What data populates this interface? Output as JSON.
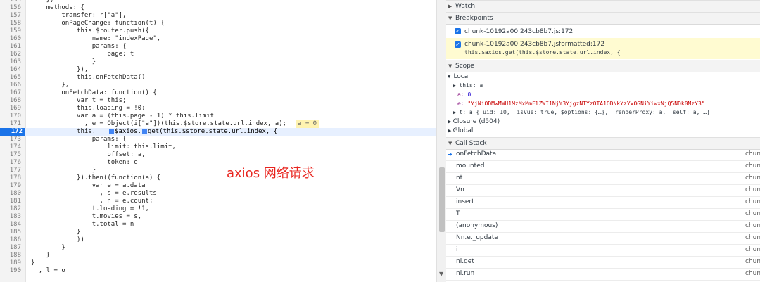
{
  "editor": {
    "lines": [
      {
        "n": "155",
        "code": "    },"
      },
      {
        "n": "156",
        "code": "    methods: {"
      },
      {
        "n": "157",
        "code": "        transfer: r[\"a\"],"
      },
      {
        "n": "158",
        "code": "        onPageChange: function(t) {"
      },
      {
        "n": "159",
        "code": "            this.$router.push({"
      },
      {
        "n": "160",
        "code": "                name: \"indexPage\","
      },
      {
        "n": "161",
        "code": "                params: {"
      },
      {
        "n": "162",
        "code": "                    page: t"
      },
      {
        "n": "163",
        "code": "                }"
      },
      {
        "n": "164",
        "code": "            }),"
      },
      {
        "n": "165",
        "code": "            this.onFetchData()"
      },
      {
        "n": "166",
        "code": "        },"
      },
      {
        "n": "167",
        "code": "        onFetchData: function() {"
      },
      {
        "n": "168",
        "code": "            var t = this;"
      },
      {
        "n": "169",
        "code": "            this.loading = !0;"
      },
      {
        "n": "170",
        "code": "            var a = (this.page - 1) * this.limit"
      },
      {
        "n": "171",
        "code": "              , e = Object(i[\"a\"])(this.$store.state.url.index, a);"
      },
      {
        "n": "172",
        "code": "            this."
      },
      {
        "n": "173",
        "code": "                params: {"
      },
      {
        "n": "174",
        "code": "                    limit: this.limit,"
      },
      {
        "n": "175",
        "code": "                    offset: a,"
      },
      {
        "n": "176",
        "code": "                    token: e"
      },
      {
        "n": "177",
        "code": "                }"
      },
      {
        "n": "178",
        "code": "            }).then((function(a) {"
      },
      {
        "n": "179",
        "code": "                var e = a.data"
      },
      {
        "n": "180",
        "code": "                  , s = e.results"
      },
      {
        "n": "181",
        "code": "                  , n = e.count;"
      },
      {
        "n": "182",
        "code": "                t.loading = !1,"
      },
      {
        "n": "183",
        "code": "                t.movies = s,"
      },
      {
        "n": "184",
        "code": "                t.total = n"
      },
      {
        "n": "185",
        "code": "            }"
      },
      {
        "n": "186",
        "code": "            ))"
      },
      {
        "n": "187",
        "code": "        }"
      },
      {
        "n": "188",
        "code": "    }"
      },
      {
        "n": "189",
        "code": "}"
      },
      {
        "n": "190",
        "code": "  , l = o"
      }
    ],
    "inline_value_171": "a = 0",
    "active_172_p1": "$axios.",
    "active_172_p2": "get(this.$store.state.url.index, {",
    "annotation": "axios 网络请求"
  },
  "panel": {
    "watch": "Watch",
    "breakpoints": "Breakpoints",
    "bp1": "chunk-10192a00.243cb8b7.js:172",
    "bp2_line1": "chunk-10192a00.243cb8b7.jsformatted:172",
    "bp2_line2": "this.$axios.get(this.$store.state.url.index, {",
    "scope": "Scope",
    "local": "Local",
    "this_row": "this: a",
    "a_key": "a: ",
    "a_val": "0",
    "e_key": "e: ",
    "e_val": "\"YjNiODMwMWU1MzMxMmFlZWI1NjY3YjgzNTYzOTA1ODNkYzYxOGNiYiwxNjQ5NDk0MzY3\"",
    "t_row": "t: a {_uid: 10, _isVue: true, $options: {…}, _renderProxy: a, _self: a, …}",
    "closure": "Closure (d504)",
    "global": "Global",
    "callstack": "Call Stack",
    "frames": [
      {
        "name": "onFetchData",
        "loc": "chun"
      },
      {
        "name": "mounted",
        "loc": "chun"
      },
      {
        "name": "nt",
        "loc": "chun"
      },
      {
        "name": "Vn",
        "loc": "chun"
      },
      {
        "name": "insert",
        "loc": "chun"
      },
      {
        "name": "T",
        "loc": "chun"
      },
      {
        "name": "(anonymous)",
        "loc": "chun"
      },
      {
        "name": "Nn.e._update",
        "loc": "chun"
      },
      {
        "name": "i",
        "loc": "chun"
      },
      {
        "name": "ni.get",
        "loc": "chun"
      },
      {
        "name": "ni.run",
        "loc": "chun"
      }
    ]
  },
  "colors": {
    "active_line": "#1a73e8",
    "breakpoint_highlight": "#fffbd1",
    "annotation": "#e8251f"
  }
}
